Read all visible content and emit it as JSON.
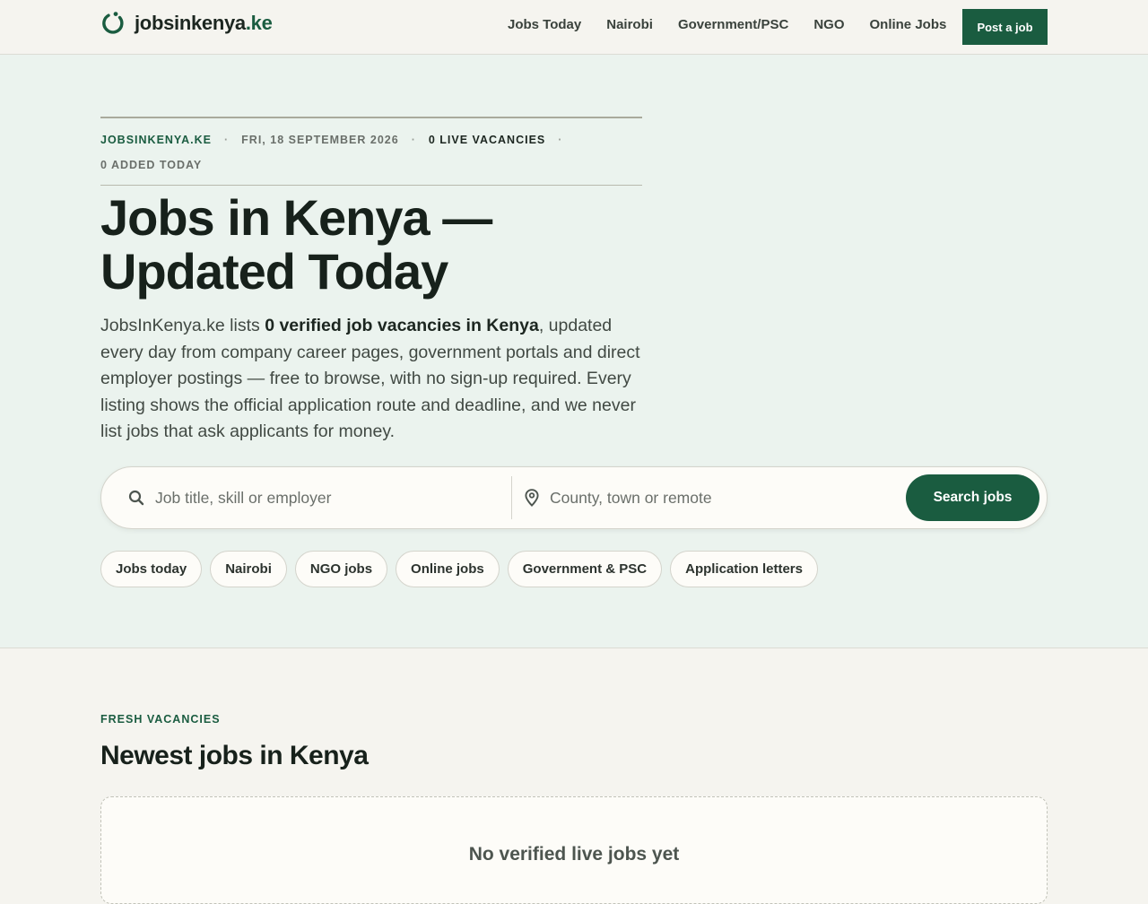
{
  "header": {
    "logo_name": "jobsinkenya",
    "logo_tld": ".ke",
    "nav": [
      "Jobs Today",
      "Nairobi",
      "Government/PSC",
      "NGO",
      "Online Jobs"
    ],
    "post_label": "Post a job"
  },
  "hero": {
    "meta": {
      "brand": "JOBSINKENYA.KE",
      "date": "FRI, 18 SEPTEMBER 2026",
      "live": "0 LIVE VACANCIES",
      "added": "0 ADDED TODAY"
    },
    "title_line1": "Jobs in Kenya —",
    "title_line2": "Updated Today",
    "lead_before": "JobsInKenya.ke lists ",
    "lead_bold": "0 verified job vacancies in Kenya",
    "lead_after": ", updated every day from company career pages, government portals and direct employer postings — free to browse, with no sign-up required. Every listing shows the official application route and deadline, and we never list jobs that ask applicants for money."
  },
  "search": {
    "query_placeholder": "Job title, skill or employer",
    "location_placeholder": "County, town or remote",
    "button_label": "Search jobs"
  },
  "chips": [
    "Jobs today",
    "Nairobi",
    "NGO jobs",
    "Online jobs",
    "Government & PSC",
    "Application letters"
  ],
  "section": {
    "eyebrow": "FRESH VACANCIES",
    "title": "Newest jobs in Kenya",
    "empty_title": "No verified live jobs yet"
  },
  "colors": {
    "brand_green": "#1a5c40",
    "hero_bg": "#ebf3ee",
    "page_bg": "#f5f4ef"
  }
}
